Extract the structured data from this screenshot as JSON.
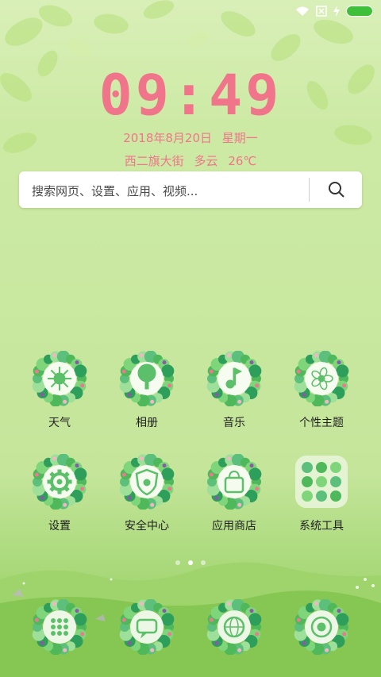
{
  "status_bar": {
    "icons": [
      "wifi-icon",
      "sim-card-icon",
      "charging-icon",
      "battery-icon"
    ],
    "battery_color": "#3fbf3a"
  },
  "lockscreen": {
    "time": "09:49",
    "date": "2018年8月20日",
    "weekday": "星期一",
    "location": "西二旗大街",
    "weather": "多云",
    "temperature": "26℃",
    "accent_color": "#f0758a"
  },
  "search": {
    "placeholder": "搜索网页、设置、应用、视频..."
  },
  "apps": [
    {
      "label": "天气",
      "icon": "sun-icon"
    },
    {
      "label": "相册",
      "icon": "tree-icon"
    },
    {
      "label": "音乐",
      "icon": "music-icon"
    },
    {
      "label": "个性主题",
      "icon": "flower-icon"
    },
    {
      "label": "设置",
      "icon": "gear-icon"
    },
    {
      "label": "安全中心",
      "icon": "shield-icon"
    },
    {
      "label": "应用商店",
      "icon": "bag-icon"
    },
    {
      "label": "系统工具",
      "icon": "folder-grid-icon"
    }
  ],
  "dock": [
    {
      "icon": "dialer-icon"
    },
    {
      "icon": "messages-icon"
    },
    {
      "icon": "browser-icon"
    },
    {
      "icon": "camera-icon"
    }
  ],
  "pages": {
    "count": 3,
    "active": 1
  }
}
